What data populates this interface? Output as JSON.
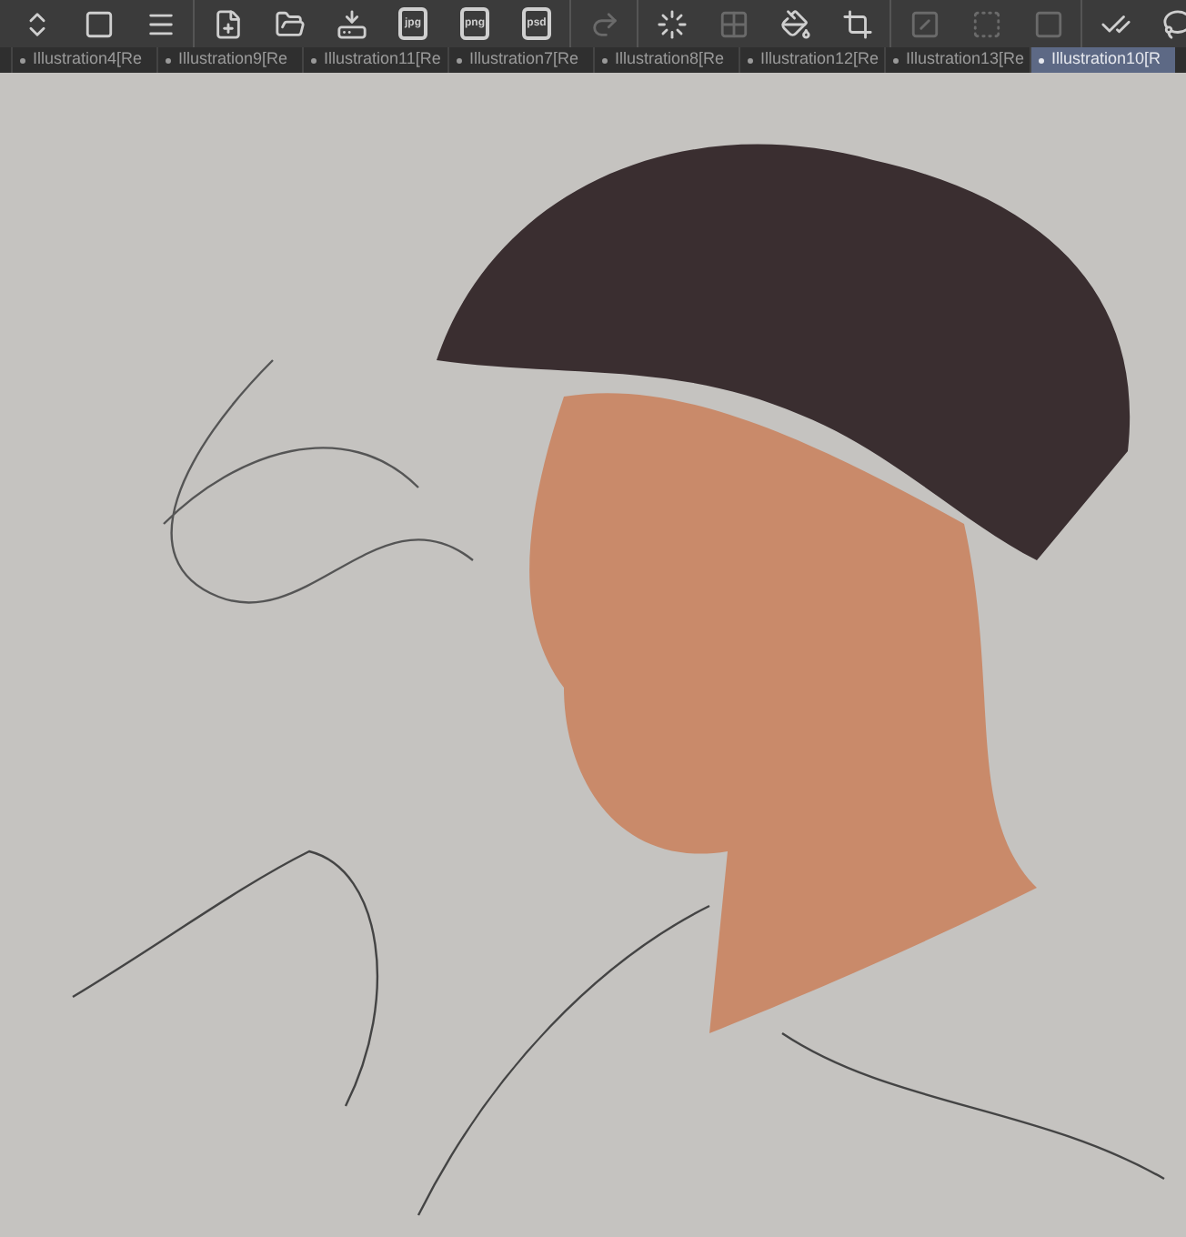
{
  "toolbar": {
    "groups": [
      [
        {
          "kind": "updown",
          "disabled": false
        },
        {
          "kind": "app",
          "disabled": false
        },
        {
          "kind": "menu",
          "disabled": false
        }
      ],
      [
        {
          "kind": "new",
          "disabled": false
        },
        {
          "kind": "open",
          "disabled": false
        },
        {
          "kind": "save",
          "disabled": false
        },
        {
          "kind": "export",
          "label": "jpg",
          "disabled": false
        },
        {
          "kind": "export",
          "label": "png",
          "disabled": false
        },
        {
          "kind": "export",
          "label": "psd",
          "disabled": false
        }
      ],
      [
        {
          "kind": "redo",
          "disabled": true
        }
      ],
      [
        {
          "kind": "loading",
          "disabled": false
        },
        {
          "kind": "transform",
          "disabled": true
        },
        {
          "kind": "fill",
          "disabled": false
        },
        {
          "kind": "crop",
          "disabled": false
        }
      ],
      [
        {
          "kind": "clear",
          "disabled": true
        },
        {
          "kind": "half",
          "disabled": true
        },
        {
          "kind": "frame",
          "disabled": true
        }
      ],
      [
        {
          "kind": "check",
          "disabled": false
        },
        {
          "kind": "lasso",
          "disabled": false
        }
      ]
    ]
  },
  "tabs": [
    {
      "label": "Illustration4[Re",
      "selected": false
    },
    {
      "label": "Illustration9[Re",
      "selected": false
    },
    {
      "label": "Illustration11[Re",
      "selected": false
    },
    {
      "label": "Illustration7[Re",
      "selected": false
    },
    {
      "label": "Illustration8[Re",
      "selected": false
    },
    {
      "label": "Illustration12[Re",
      "selected": false
    },
    {
      "label": "Illustration13[Re",
      "selected": false
    },
    {
      "label": "Illustration10[R",
      "selected": true
    }
  ]
}
